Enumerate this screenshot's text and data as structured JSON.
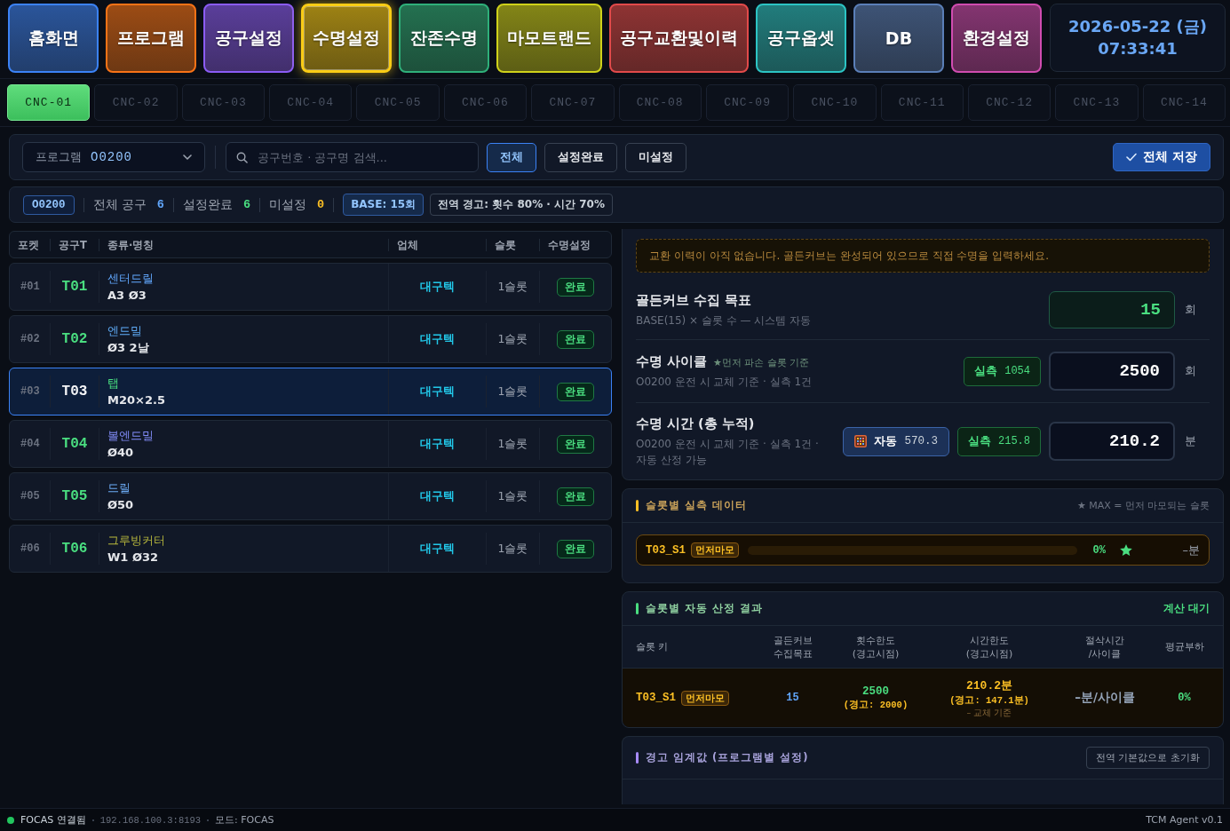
{
  "nav": {
    "items": [
      {
        "label": "홈화면",
        "color": "#3b82f6",
        "selected": false
      },
      {
        "label": "프로그램",
        "color": "#f97316",
        "selected": false
      },
      {
        "label": "공구설정",
        "color": "#8b5cf6",
        "selected": false
      },
      {
        "label": "수명설정",
        "color": "#facc15",
        "selected": true
      },
      {
        "label": "잔존수명",
        "color": "#2fb07a",
        "selected": false
      },
      {
        "label": "마모트랜드",
        "color": "#cfd21a",
        "selected": false
      },
      {
        "label": "공구교환및이력",
        "color": "#e24a4a",
        "selected": false
      },
      {
        "label": "공구옵셋",
        "color": "#2cc4c4",
        "selected": false
      },
      {
        "label": "DB",
        "color": "#5b7fb8",
        "selected": false
      },
      {
        "label": "환경설정",
        "color": "#d04cb0",
        "selected": false
      }
    ],
    "clock": {
      "date": "2026-05-22 (금)",
      "time": "07:33:41"
    }
  },
  "machine_tabs": [
    {
      "label": "CNC-01",
      "selected": true
    },
    {
      "label": "CNC-02",
      "selected": false
    },
    {
      "label": "CNC-03",
      "selected": false
    },
    {
      "label": "CNC-04",
      "selected": false
    },
    {
      "label": "CNC-05",
      "selected": false
    },
    {
      "label": "CNC-06",
      "selected": false
    },
    {
      "label": "CNC-07",
      "selected": false
    },
    {
      "label": "CNC-08",
      "selected": false
    },
    {
      "label": "CNC-09",
      "selected": false
    },
    {
      "label": "CNC-10",
      "selected": false
    },
    {
      "label": "CNC-11",
      "selected": false
    },
    {
      "label": "CNC-12",
      "selected": false
    },
    {
      "label": "CNC-13",
      "selected": false
    },
    {
      "label": "CNC-14",
      "selected": false
    }
  ],
  "filter_bar": {
    "program_select": {
      "label": "프로그램",
      "value": "O0200"
    },
    "search": {
      "placeholder": "공구번호 · 공구명 검색..."
    },
    "filters": [
      {
        "label": "전체",
        "selected": true
      },
      {
        "label": "설정완료",
        "selected": false
      },
      {
        "label": "미설정",
        "selected": false
      }
    ],
    "save_button": "전체 저장"
  },
  "summary": {
    "program": "O0200",
    "stats": [
      {
        "label": "전체 공구",
        "value": "6",
        "color": "#60a5fa"
      },
      {
        "label": "설정완료",
        "value": "6",
        "color": "#4ade80"
      },
      {
        "label": "미설정",
        "value": "0",
        "color": "#fbbf24"
      }
    ],
    "base": "BASE: 15회",
    "global_warning": "전역 경고: 횟수 80% · 시간 70%"
  },
  "tool_table": {
    "columns": [
      "포켓",
      "공구T",
      "종류·명칭",
      "업체",
      "슬롯",
      "수명설정"
    ],
    "rows": [
      {
        "pocket": "#01",
        "tool": "T01",
        "type": "센터드릴",
        "color": "#60a5fa",
        "name": "A3 Ø3",
        "vendor": "대구텍",
        "slots": "1슬롯",
        "status": "완료",
        "selected": false
      },
      {
        "pocket": "#02",
        "tool": "T02",
        "type": "엔드밀",
        "color": "#5eaaf5",
        "name": "Ø3 2날",
        "vendor": "대구텍",
        "slots": "1슬롯",
        "status": "완료",
        "selected": false
      },
      {
        "pocket": "#03",
        "tool": "T03",
        "type": "탭",
        "color": "#4ade80",
        "name": "M20×2.5",
        "vendor": "대구텍",
        "slots": "1슬롯",
        "status": "완료",
        "selected": true
      },
      {
        "pocket": "#04",
        "tool": "T04",
        "type": "볼엔드밀",
        "color": "#818cf8",
        "name": "Ø40",
        "vendor": "대구텍",
        "slots": "1슬롯",
        "status": "완료",
        "selected": false
      },
      {
        "pocket": "#05",
        "tool": "T05",
        "type": "드릴",
        "color": "#6aa8f0",
        "name": "Ø50",
        "vendor": "대구텍",
        "slots": "1슬롯",
        "status": "완료",
        "selected": false
      },
      {
        "pocket": "#06",
        "tool": "T06",
        "type": "그루빙커터",
        "color": "#b4b43c",
        "name": "W1 Ø32",
        "vendor": "대구텍",
        "slots": "1슬롯",
        "status": "완료",
        "selected": false
      }
    ]
  },
  "life_settings": {
    "notice": "교환 이력이 아직 없습니다. 골든커브는 완성되어 있으므로 직접 수명을 입력하세요.",
    "fields": [
      {
        "kind": "auto",
        "title": "골든커브 수집 목표",
        "subtitle": "BASE(15) × 슬롯 수 — 시스템 자동",
        "value": "15",
        "unit": "회"
      },
      {
        "kind": "input",
        "title": "수명 사이클",
        "note": "★먼저 파손 슬롯 기준",
        "subtitle": "O0200 운전 시 교체 기준 · 실측 1건",
        "measured": {
          "label": "실측",
          "value": "1054"
        },
        "value": "2500",
        "unit": "회"
      },
      {
        "kind": "input",
        "title": "수명 시간 (총 누적)",
        "subtitle": "O0200 운전 시 교체 기준 · 실측 1건 · 자동 산정 가능",
        "auto": {
          "label": "자동",
          "value": "570.3"
        },
        "measured": {
          "label": "실측",
          "value": "215.8"
        },
        "value": "210.2",
        "unit": "분"
      }
    ]
  },
  "slot_data": {
    "title": "슬롯별 실측 데이터",
    "legend": "★ MAX = 먼저 마모되는 슬롯",
    "slots": [
      {
        "key": "T03_S1",
        "badge": "먼저마모",
        "percent": "0%",
        "max": true,
        "time": "–분"
      }
    ]
  },
  "auto_results": {
    "title": "슬롯별 자동 산정 결과",
    "status": "계산 대기",
    "columns": [
      "슬롯 키",
      "골든커브\n수집목표",
      "횟수한도\n(경고시점)",
      "시간한도\n(경고시점)",
      "절삭시간\n/사이클",
      "평균부하"
    ],
    "rows": [
      {
        "key": "T03_S1",
        "badge": "먼저마모",
        "target": "15",
        "count_limit": "2500",
        "count_warning": "(경고: 2000)",
        "time_limit": "210.2분",
        "time_warning": "(경고: 147.1분)",
        "time_note": "– 교체 기준",
        "cycle_time": "–분/사이클",
        "avg_load": "0%"
      }
    ]
  },
  "warning_thresholds": {
    "title": "경고 임계값 (프로그램별 설정)",
    "reset_button": "전역 기본값으로 초기화"
  },
  "status_bar": {
    "connected": true,
    "connection": "FOCAS 연결됨",
    "address": "192.168.100.3:8193",
    "mode": "모드: FOCAS",
    "version": "TCM Agent v0.1"
  }
}
